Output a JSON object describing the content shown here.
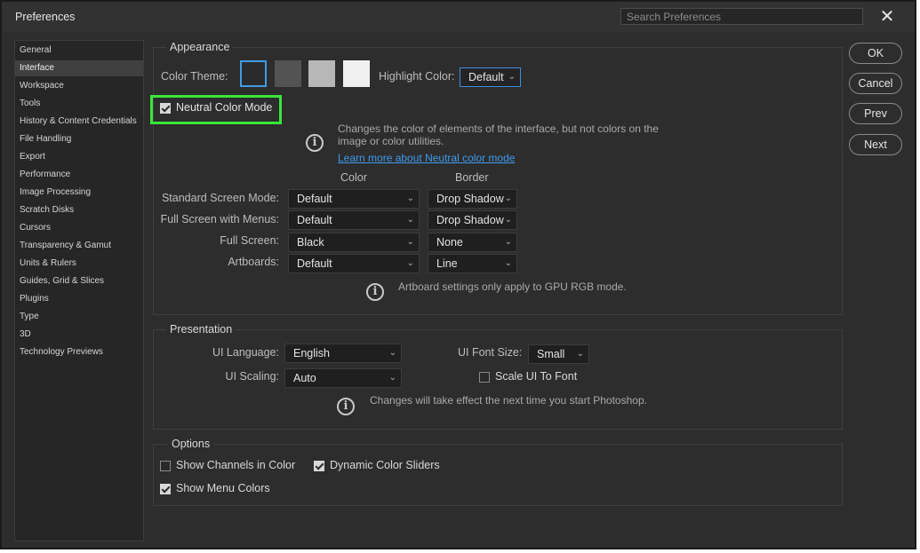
{
  "window": {
    "title": "Preferences",
    "search_placeholder": "Search Preferences",
    "close_glyph": "✕"
  },
  "nav": {
    "items": [
      "General",
      "Interface",
      "Workspace",
      "Tools",
      "History & Content Credentials",
      "File Handling",
      "Export",
      "Performance",
      "Image Processing",
      "Scratch Disks",
      "Cursors",
      "Transparency & Gamut",
      "Units & Rulers",
      "Guides, Grid & Slices",
      "Plugins",
      "Type",
      "3D",
      "Technology Previews"
    ],
    "active": "Interface"
  },
  "buttons": {
    "ok": "OK",
    "cancel": "Cancel",
    "prev": "Prev",
    "next": "Next"
  },
  "appearance": {
    "title": "Appearance",
    "color_theme_label": "Color Theme:",
    "swatches": [
      "#2a2a2a",
      "#535353",
      "#b7b7b7",
      "#f0f0f0"
    ],
    "highlight_label": "Highlight Color:",
    "highlight_value": "Default",
    "neutral_label": "Neutral Color Mode",
    "neutral_checked": true,
    "neutral_info": "Changes the color of elements of the interface, but not colors on the image or color utilities.",
    "neutral_link": "Learn more about Neutral color mode",
    "col_color": "Color",
    "col_border": "Border",
    "rows": [
      {
        "label": "Standard Screen Mode:",
        "color": "Default",
        "border": "Drop Shadow"
      },
      {
        "label": "Full Screen with Menus:",
        "color": "Default",
        "border": "Drop Shadow"
      },
      {
        "label": "Full Screen:",
        "color": "Black",
        "border": "None"
      },
      {
        "label": "Artboards:",
        "color": "Default",
        "border": "Line"
      }
    ],
    "artboard_info": "Artboard settings only apply to GPU RGB mode."
  },
  "presentation": {
    "title": "Presentation",
    "ui_language_label": "UI Language:",
    "ui_language": "English",
    "ui_font_size_label": "UI Font Size:",
    "ui_font_size": "Small",
    "ui_scaling_label": "UI Scaling:",
    "ui_scaling": "Auto",
    "scale_ui_label": "Scale UI To Font",
    "scale_ui_checked": false,
    "info": "Changes will take effect the next time you start Photoshop."
  },
  "options": {
    "title": "Options",
    "show_channels_label": "Show Channels in Color",
    "show_channels_checked": false,
    "dynamic_sliders_label": "Dynamic Color Sliders",
    "dynamic_sliders_checked": true,
    "show_menu_colors_label": "Show Menu Colors",
    "show_menu_colors_checked": true
  },
  "colors": {
    "accent_link": "#3f9bf0",
    "highlight_box": "#39e639",
    "selected_swatch_border": "#3e9ce6"
  }
}
